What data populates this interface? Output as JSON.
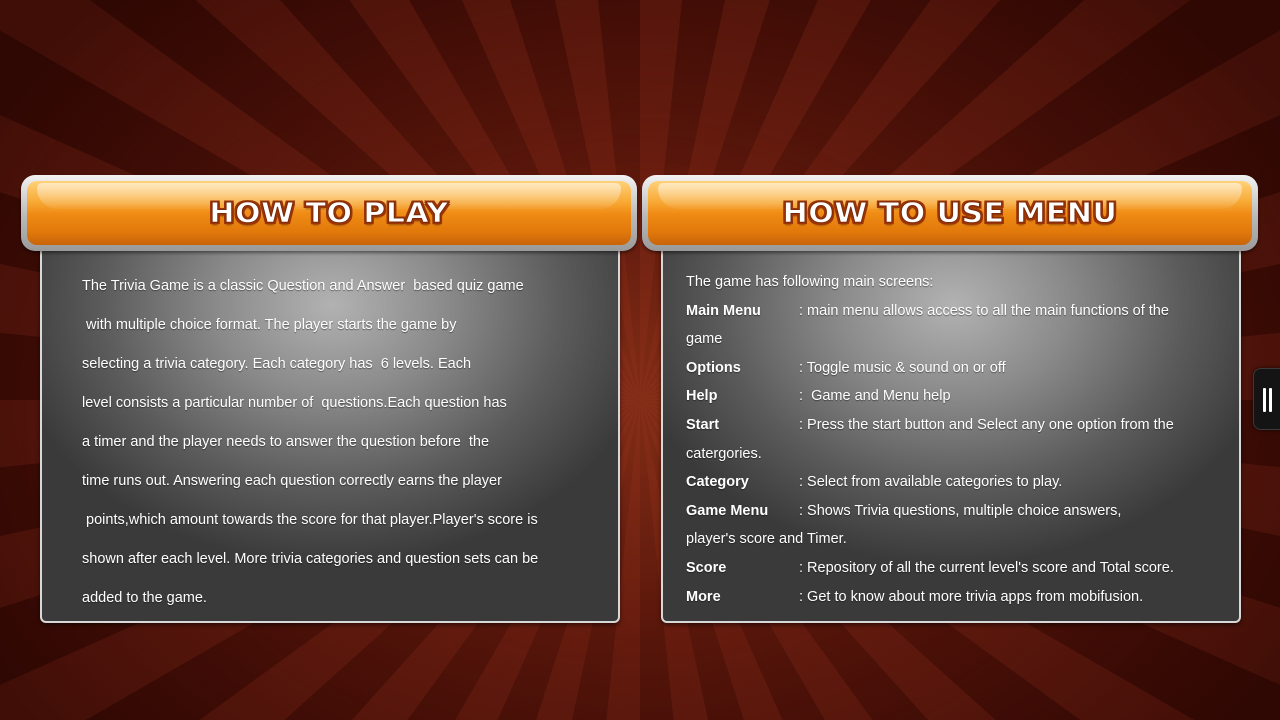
{
  "how_to_play": {
    "title": "HOW TO PLAY",
    "lines": [
      "The Trivia Game is a classic Question and Answer  based quiz game",
      " with multiple choice format. The player starts the game by",
      "selecting a trivia category. Each category has  6 levels. Each",
      "level consists a particular number of  questions.Each question has",
      "a timer and the player needs to answer the question before  the",
      "time runs out. Answering each question correctly earns the player",
      " points,which amount towards the score for that player.Player's score is",
      "shown after each level. More trivia categories and question sets can be",
      "added to the game."
    ]
  },
  "how_to_use_menu": {
    "title": "HOW TO USE MENU",
    "intro": "The game has following main screens:",
    "items": [
      {
        "term": "Main Menu",
        "desc": ": main menu allows access to all the main functions of the",
        "wrap": "game"
      },
      {
        "term": "Options",
        "desc": ": Toggle music & sound on or off",
        "wrap": ""
      },
      {
        "term": "Help",
        "desc": ":  Game and Menu help",
        "wrap": ""
      },
      {
        "term": "Start",
        "desc": ": Press the start button and Select any one option from the",
        "wrap": "catergories."
      },
      {
        "term": "Category",
        "desc": ": Select from available categories to play.",
        "wrap": ""
      },
      {
        "term": "Game Menu",
        "desc": ": Shows Trivia questions, multiple choice answers,",
        "wrap": "player's score and Timer."
      },
      {
        "term": "Score",
        "desc": ": Repository of all the current level's score and Total score.",
        "wrap": ""
      },
      {
        "term": "More",
        "desc": ": Get to know about more trivia apps from mobifusion.",
        "wrap": ""
      }
    ]
  },
  "controls": {
    "pause_icon": "pause-icon"
  }
}
